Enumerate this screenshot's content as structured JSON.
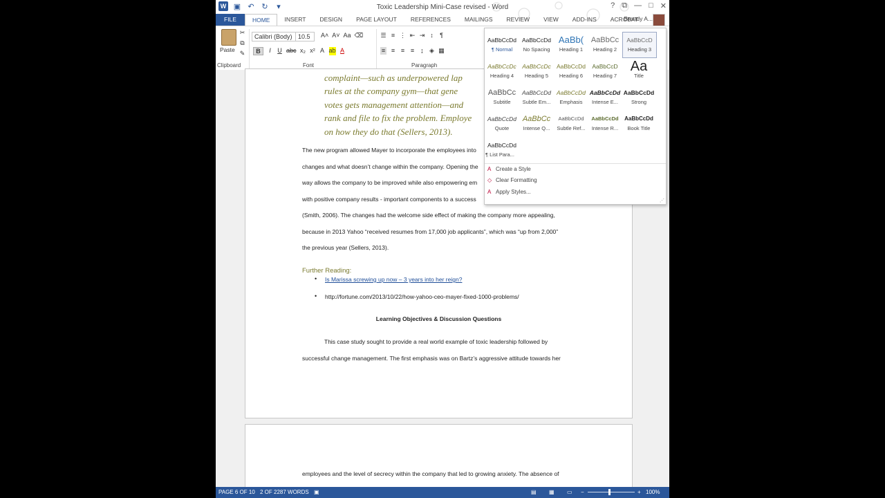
{
  "title": "Toxic Leadership Mini-Case revised - Word",
  "quick_access": [
    "word-icon",
    "save-icon",
    "undo-icon",
    "redo-icon",
    "customize-icon"
  ],
  "window_controls": [
    "?",
    "restore",
    "—",
    "□",
    "✕"
  ],
  "tabs": [
    "FILE",
    "HOME",
    "INSERT",
    "DESIGN",
    "PAGE LAYOUT",
    "REFERENCES",
    "MAILINGS",
    "REVIEW",
    "VIEW",
    "ADD-INS",
    "ACROBAT"
  ],
  "active_tab": "HOME",
  "user": "Brandy A...",
  "ribbon": {
    "paste": "Paste",
    "clipboard": "Clipboard",
    "font": "Font",
    "paragraph": "Paragraph",
    "font_name": "Calibri (Body)",
    "font_size": "10.5"
  },
  "styles": [
    {
      "preview": "AaBbCcDd",
      "name": "¶ Normal"
    },
    {
      "preview": "AaBbCcDd",
      "name": "No Spacing"
    },
    {
      "preview": "AaBb(",
      "name": "Heading 1"
    },
    {
      "preview": "AaBbCc",
      "name": "Heading 2"
    },
    {
      "preview": "AaBbCcD",
      "name": "Heading 3"
    },
    {
      "preview": "AaBbCcDc",
      "name": "Heading 4"
    },
    {
      "preview": "AaBbCcDc",
      "name": "Heading 5"
    },
    {
      "preview": "AaBbCcDd",
      "name": "Heading 6"
    },
    {
      "preview": "AaBbCcD",
      "name": "Heading 7"
    },
    {
      "preview": "Aa",
      "name": "Title"
    },
    {
      "preview": "AaBbCc",
      "name": "Subtitle"
    },
    {
      "preview": "AaBbCcDd",
      "name": "Subtle Em..."
    },
    {
      "preview": "AaBbCcDd",
      "name": "Emphasis"
    },
    {
      "preview": "AaBbCcDd",
      "name": "Intense E..."
    },
    {
      "preview": "AaBbCcDd",
      "name": "Strong"
    },
    {
      "preview": "AaBbCcDd",
      "name": "Quote"
    },
    {
      "preview": "AaBbCc",
      "name": "Intense Q..."
    },
    {
      "preview": "AaBbCcDd",
      "name": "Subtle Ref..."
    },
    {
      "preview": "AaBbCcDd",
      "name": "Intense R..."
    },
    {
      "preview": "AaBbCcDd",
      "name": "Book Title"
    },
    {
      "preview": "AaBbCcDd",
      "name": "¶ List Para..."
    }
  ],
  "gallery_actions": [
    "Create a Style",
    "Clear Formatting",
    "Apply Styles..."
  ],
  "document": {
    "quote_lines": [
      "complaint—such as underpowered lap",
      "rules at the company gym—that gene",
      "votes gets management attention—and",
      "rank and file to fix the problem. Employe",
      "on how they do that (Sellers, 2013)."
    ],
    "body_lines": [
      "The new program allowed Mayer to incorporate the employees into",
      "changes and what doesn’t change within the company. Opening the",
      "way allows the company to be improved while also empowering em",
      "with positive company results - important components to a success",
      "(Smith, 2006). The changes had the welcome side effect of making the company more appealing,",
      "because in 2013 Yahoo “received resumes from 17,000 job applicants”, which was “up from 2,000”",
      "the previous year (Sellers, 2013)."
    ],
    "further_reading": "Further Reading:",
    "link1": "Is Marissa screwing up now – 3 years into her reign?",
    "link2": "http://fortune.com/2013/10/22/how-yahoo-ceo-mayer-fixed-1000-problems/",
    "heading": "Learning Objectives & Discussion Questions",
    "para_first": "This case study sought to provide a real world example of toxic leadership followed by",
    "para_second": "successful change management. The first emphasis was on Bartz’s aggressive attitude towards her",
    "next_page_line": "employees and the level of secrecy within the company that led to growing anxiety. The absence of"
  },
  "status": {
    "page": "PAGE 6 OF 10",
    "words": "2 OF 2287 WORDS",
    "zoom": "100%"
  }
}
